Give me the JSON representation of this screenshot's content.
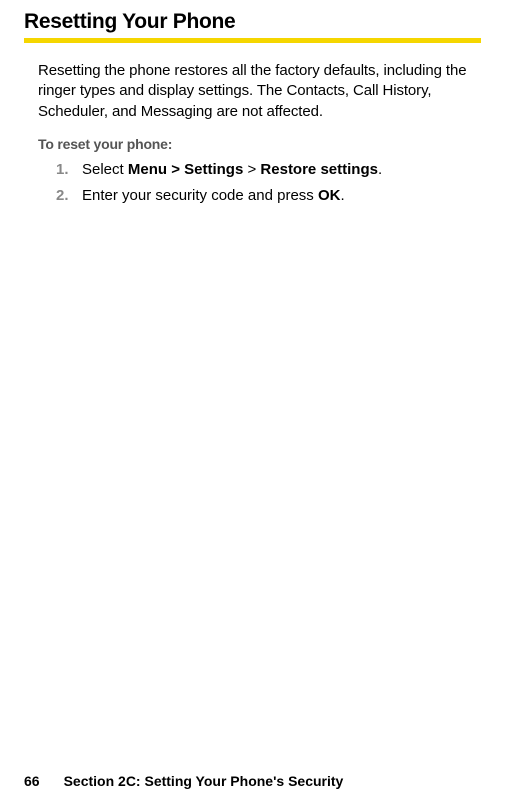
{
  "heading": "Resetting Your Phone",
  "intro": "Resetting the phone restores all the factory defaults, including the ringer types and display settings. The Contacts, Call History, Scheduler, and Messaging are not affected.",
  "subheading": "To reset your phone:",
  "steps": {
    "s1": {
      "num": "1.",
      "prefix": "Select ",
      "b1": "Menu > ",
      "b2": "Settings",
      "mid": " > ",
      "b3": "Restore settings",
      "suffix": "."
    },
    "s2": {
      "num": "2.",
      "prefix": "Enter your security code and press ",
      "b1": "OK",
      "suffix": "."
    }
  },
  "footer": {
    "pagenum": "66",
    "section": "Section 2C: Setting Your Phone's Security"
  }
}
